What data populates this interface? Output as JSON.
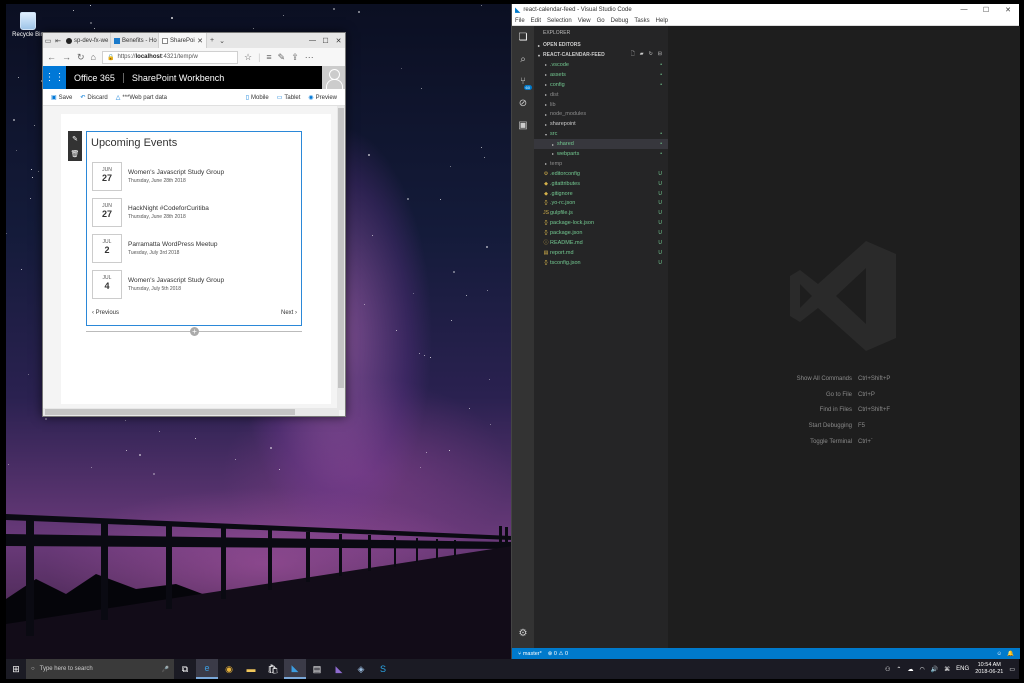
{
  "desktop": {
    "recycle_bin_label": "Recycle Bin"
  },
  "browser": {
    "tabs": [
      {
        "label": "sp-dev-fx-we",
        "icon": "github-icon"
      },
      {
        "label": "Benefits - Ho",
        "icon": "sharepoint-icon"
      },
      {
        "label": "SharePoi",
        "icon": "page-icon",
        "active": true
      }
    ],
    "url_prefix": "https://",
    "url_host": "localhost",
    "url_rest": ":4321/temp/w",
    "header": {
      "app_name": "Office 365",
      "site_name": "SharePoint Workbench"
    },
    "commands": {
      "save": "Save",
      "discard": "Discard",
      "web_part_data": "***Web part data",
      "mobile": "Mobile",
      "tablet": "Tablet",
      "preview": "Preview"
    },
    "webpart": {
      "title": "Upcoming Events",
      "events": [
        {
          "month": "JUN",
          "day": "27",
          "title": "Women's Javascript Study Group",
          "date": "Thursday, June 28th 2018"
        },
        {
          "month": "JUN",
          "day": "27",
          "title": "HackNight #CodeforCuritiba",
          "date": "Thursday, June 28th 2018"
        },
        {
          "month": "JUL",
          "day": "2",
          "title": "Parramatta WordPress Meetup",
          "date": "Tuesday, July 3rd 2018"
        },
        {
          "month": "JUL",
          "day": "4",
          "title": "Women's Javascript Study Group",
          "date": "Thursday, July 5th 2018"
        }
      ],
      "previous": "Previous",
      "next": "Next"
    }
  },
  "vscode": {
    "title": "react-calendar-feed - Visual Studio Code",
    "menu": [
      "File",
      "Edit",
      "Selection",
      "View",
      "Go",
      "Debug",
      "Tasks",
      "Help"
    ],
    "source_control_badge": "60",
    "explorer_title": "EXPLORER",
    "open_editors": "OPEN EDITORS",
    "project": "REACT-CALENDAR-FEED",
    "tree": [
      {
        "name": ".vscode",
        "type": "folder",
        "indent": 0,
        "collapsed": true,
        "color": "#73c991",
        "badge": "•"
      },
      {
        "name": "assets",
        "type": "folder",
        "indent": 0,
        "collapsed": true,
        "color": "#73c991",
        "badge": "•"
      },
      {
        "name": "config",
        "type": "folder",
        "indent": 0,
        "collapsed": true,
        "color": "#73c991",
        "badge": "•"
      },
      {
        "name": "dist",
        "type": "folder",
        "indent": 0,
        "collapsed": true,
        "color": "#8c8c8c",
        "badge": ""
      },
      {
        "name": "lib",
        "type": "folder",
        "indent": 0,
        "collapsed": true,
        "color": "#8c8c8c",
        "badge": ""
      },
      {
        "name": "node_modules",
        "type": "folder",
        "indent": 0,
        "collapsed": true,
        "color": "#8c8c8c",
        "badge": ""
      },
      {
        "name": "sharepoint",
        "type": "folder",
        "indent": 0,
        "collapsed": true,
        "color": "#cccccc",
        "badge": ""
      },
      {
        "name": "src",
        "type": "folder",
        "indent": 0,
        "collapsed": false,
        "color": "#73c991",
        "badge": "•"
      },
      {
        "name": "shared",
        "type": "folder",
        "indent": 1,
        "collapsed": true,
        "color": "#73c991",
        "badge": "•",
        "selected": true
      },
      {
        "name": "webparts",
        "type": "folder",
        "indent": 1,
        "collapsed": true,
        "color": "#73c991",
        "badge": "•"
      },
      {
        "name": "temp",
        "type": "folder",
        "indent": 0,
        "collapsed": true,
        "color": "#8c8c8c",
        "badge": ""
      },
      {
        "name": ".editorconfig",
        "type": "file",
        "indent": 0,
        "icon": "⚙",
        "color": "#73c991",
        "badge": "U"
      },
      {
        "name": ".gitattributes",
        "type": "file",
        "indent": 0,
        "icon": "◆",
        "color": "#73c991",
        "badge": "U"
      },
      {
        "name": ".gitignore",
        "type": "file",
        "indent": 0,
        "icon": "◆",
        "color": "#73c991",
        "badge": "U"
      },
      {
        "name": ".yo-rc.json",
        "type": "file",
        "indent": 0,
        "icon": "{}",
        "color": "#73c991",
        "badge": "U"
      },
      {
        "name": "gulpfile.js",
        "type": "file",
        "indent": 0,
        "icon": "JS",
        "color": "#73c991",
        "badge": "U"
      },
      {
        "name": "package-lock.json",
        "type": "file",
        "indent": 0,
        "icon": "{}",
        "color": "#73c991",
        "badge": "U"
      },
      {
        "name": "package.json",
        "type": "file",
        "indent": 0,
        "icon": "{}",
        "color": "#73c991",
        "badge": "U"
      },
      {
        "name": "README.md",
        "type": "file",
        "indent": 0,
        "icon": "ⓘ",
        "color": "#73c991",
        "badge": "U"
      },
      {
        "name": "report.md",
        "type": "file",
        "indent": 0,
        "icon": "▤",
        "color": "#73c991",
        "badge": "U"
      },
      {
        "name": "tsconfig.json",
        "type": "file",
        "indent": 0,
        "icon": "{}",
        "color": "#73c991",
        "badge": "U"
      }
    ],
    "hints": [
      {
        "label": "Show All Commands",
        "keys": "Ctrl+Shift+P"
      },
      {
        "label": "Go to File",
        "keys": "Ctrl+P"
      },
      {
        "label": "Find in Files",
        "keys": "Ctrl+Shift+F"
      },
      {
        "label": "Start Debugging",
        "keys": "F5"
      },
      {
        "label": "Toggle Terminal",
        "keys": "Ctrl+`"
      }
    ],
    "status": {
      "branch": "master*",
      "errors": "0",
      "warnings": "0"
    }
  },
  "taskbar": {
    "search_placeholder": "Type here to search",
    "lang": "ENG",
    "time": "10:54 AM",
    "date": "2018-06-21"
  },
  "colors": {
    "sp_blue": "#0078d7",
    "vs_status": "#007acc",
    "git_untracked": "#73c991"
  }
}
